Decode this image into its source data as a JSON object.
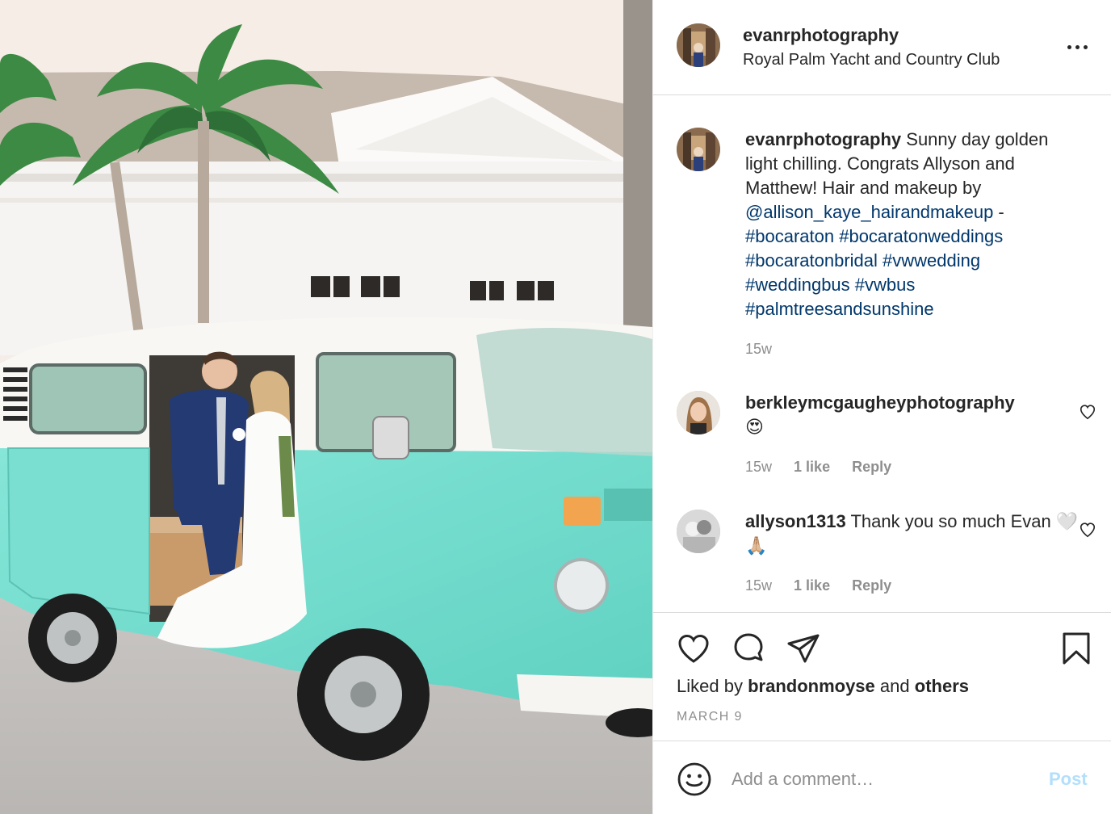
{
  "post": {
    "username": "evanrphotography",
    "location": "Royal Palm Yacht and Country Club",
    "more_icon": "more-horizontal-icon"
  },
  "caption": {
    "username": "evanrphotography",
    "text": "Sunny day golden light chilling. Congrats Allyson and Matthew! Hair and makeup by",
    "mention": "@allison_kaye_hairandmakeup",
    "dash": " -",
    "hashtags": [
      "#bocaraton",
      "#bocaratonweddings",
      "#bocaratonbridal",
      "#vwwedding",
      "#weddingbus",
      "#vwbus",
      "#palmtreesandsunshine"
    ],
    "time": "15w"
  },
  "comments": [
    {
      "username": "berkleymcgaugheyphotography",
      "text": "😍",
      "time": "15w",
      "likes": "1 like",
      "reply": "Reply"
    },
    {
      "username": "allyson1313",
      "text": "Thank you so much Evan 🤍🙏🏼",
      "time": "15w",
      "likes": "1 like",
      "reply": "Reply"
    }
  ],
  "actions": {
    "like_icon": "heart-icon",
    "comment_icon": "comment-bubble-icon",
    "share_icon": "paper-plane-icon",
    "save_icon": "bookmark-icon"
  },
  "likes": {
    "prefix": "Liked by",
    "user": "brandonmoyse",
    "and": "and",
    "others": "others"
  },
  "date": "MARCH 9",
  "comment_box": {
    "placeholder": "Add a comment…",
    "post_label": "Post"
  },
  "colors": {
    "link": "#00376b",
    "muted": "#8e8e8e",
    "post_disabled": "#b2dffc",
    "van_teal": "#7fe3d3"
  }
}
